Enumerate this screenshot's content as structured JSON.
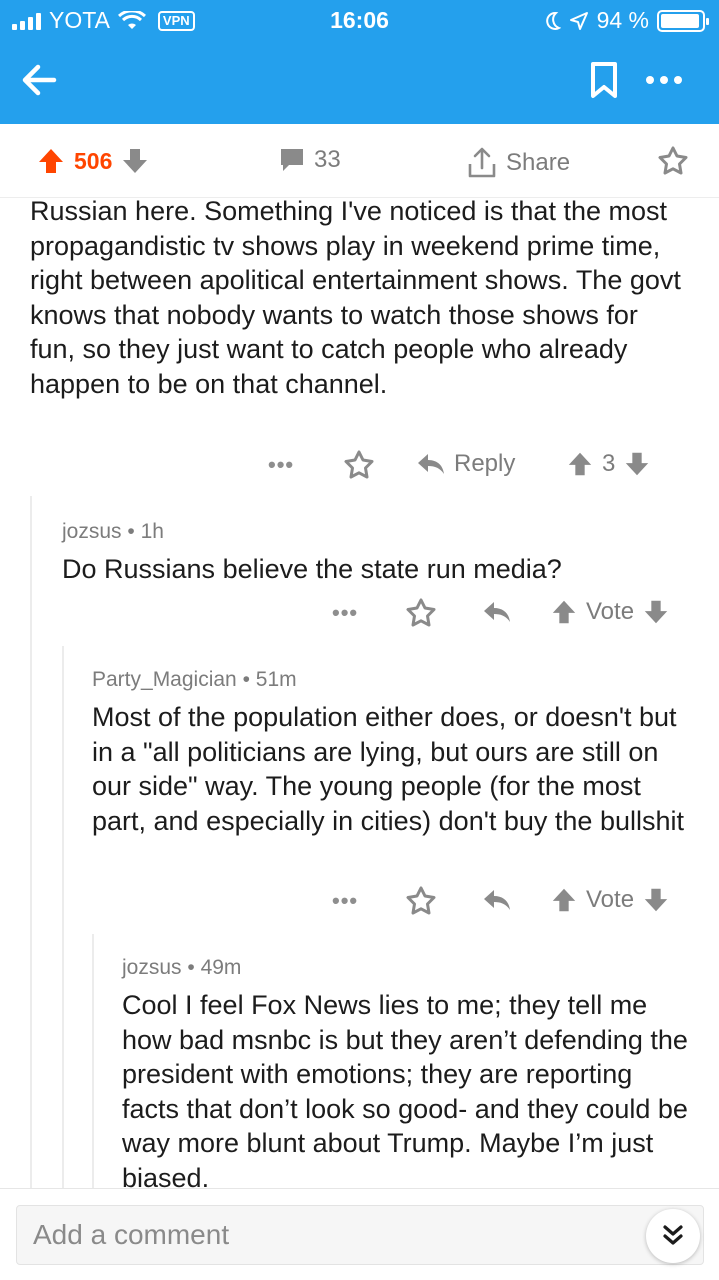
{
  "status_bar": {
    "carrier": "YOTA",
    "vpn": "VPN",
    "time": "16:06",
    "battery_text": "94 %",
    "battery_level": 0.94
  },
  "actions": {
    "votes": "506",
    "comments": "33",
    "share": "Share"
  },
  "comments": [
    {
      "author": "",
      "age": "",
      "body": "Russian here. Something I've noticed is that the most propagandistic tv shows play in weekend prime time, right between apolitical entertainment shows. The govt knows that nobody wants to watch those shows for fun, so they just want to catch people who already happen to be on that channel.",
      "reply_label": "Reply",
      "score": "3"
    },
    {
      "author": "jozsus",
      "age": "1h",
      "body": "Do Russians believe the state run media?",
      "vote_label": "Vote"
    },
    {
      "author": "Party_Magician",
      "age": "51m",
      "body": "Most of the population either does, or doesn't but in a \"all politicians are lying, but ours are still on our side\" way. The young people (for the most part, and especially in cities) don't buy the bullshit",
      "vote_label": "Vote"
    },
    {
      "author": "jozsus",
      "age": "49m",
      "body": "Cool I feel Fox News lies to me; they tell me how bad msnbc is but they aren’t defending the president with emotions; they are reporting facts that don’t look so good- and they could be way more blunt about Trump. Maybe I’m just biased."
    }
  ],
  "composer": {
    "placeholder": "Add a comment"
  },
  "icons": {
    "back": "back-arrow-icon",
    "bookmark": "bookmark-icon",
    "more": "more-icon",
    "upvote": "upvote-arrow-icon",
    "downvote": "downvote-arrow-icon",
    "comment": "comment-bubble-icon",
    "share": "share-icon",
    "star": "star-icon",
    "reply": "reply-arrow-icon",
    "jump": "double-chevron-down-icon"
  },
  "colors": {
    "header": "#24a0ed",
    "upvote_active": "#ff4500",
    "muted": "#7c7c7c"
  }
}
